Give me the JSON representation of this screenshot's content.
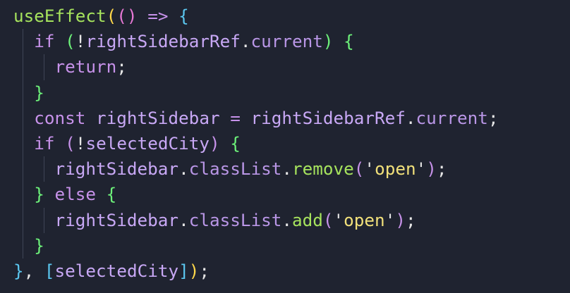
{
  "colors": {
    "background": "#1f2330",
    "function": "#a6e35d",
    "keyword": "#c792ea",
    "identifier": "#c8a8f5",
    "string": "#f1e07a",
    "bracket_yellow": "#ffd84a",
    "bracket_pink": "#e879d6",
    "bracket_blue": "#5bc7f0",
    "bracket_green": "#6df27a"
  },
  "code": {
    "l1": {
      "fn": "useEffect",
      "open_paren": "(",
      "arrow_parens": "()",
      "arrow": " => ",
      "open_brace": "{"
    },
    "l2": {
      "kw": "if",
      "open": " (",
      "neg": "!",
      "obj": "rightSidebarRef",
      "dot": ".",
      "prop": "current",
      "close": ")",
      "brace": " {"
    },
    "l3": {
      "kw": "return",
      "semi": ";"
    },
    "l4": {
      "brace": "}"
    },
    "l5": {
      "kw": "const",
      "name": " rightSidebar",
      "eq": " = ",
      "obj": "rightSidebarRef",
      "dot": ".",
      "prop": "current",
      "semi": ";"
    },
    "l6": {
      "kw": "if",
      "open": " (",
      "neg": "!",
      "var": "selectedCity",
      "close": ")",
      "brace": " {"
    },
    "l7": {
      "obj": "rightSidebar",
      "dot1": ".",
      "prop": "classList",
      "dot2": ".",
      "method": "remove",
      "open": "(",
      "q1": "'",
      "str": "open",
      "q2": "'",
      "close": ")",
      "semi": ";"
    },
    "l8": {
      "close_brace": "}",
      "kw": " else",
      "open_brace": " {"
    },
    "l9": {
      "obj": "rightSidebar",
      "dot1": ".",
      "prop": "classList",
      "dot2": ".",
      "method": "add",
      "open": "(",
      "q1": "'",
      "str": "open",
      "q2": "'",
      "close": ")",
      "semi": ";"
    },
    "l10": {
      "brace": "}"
    },
    "l11": {
      "close_brace": "}",
      "comma": ", ",
      "open_bracket": "[",
      "dep": "selectedCity",
      "close_bracket": "]",
      "close_paren": ")",
      "semi": ";"
    }
  }
}
